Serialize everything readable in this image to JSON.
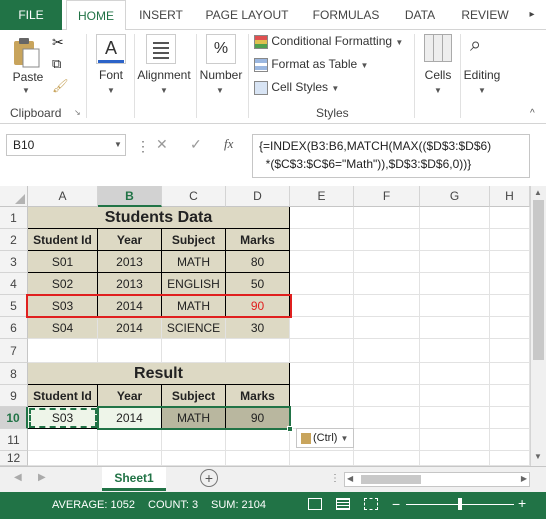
{
  "ribbon_tabs": [
    "FILE",
    "HOME",
    "INSERT",
    "PAGE LAYOUT",
    "FORMULAS",
    "DATA",
    "REVIEW"
  ],
  "clipboard": {
    "paste": "Paste",
    "label": "Clipboard"
  },
  "font_label": "Font",
  "alignment_label": "Alignment",
  "number": {
    "label": "Number",
    "symbol": "%"
  },
  "styles": {
    "conditional": "Conditional Formatting",
    "format_table": "Format as Table",
    "cell_styles": "Cell Styles",
    "label": "Styles"
  },
  "cells_label": "Cells",
  "editing_label": "Editing",
  "name_box": "B10",
  "fx": "fx",
  "formula": "{=INDEX(B3:B6,MATCH(MAX(($D$3:$D$6)\n  *($C$3:$C$6=\"Math\")),$D$3:$D$6,0))}",
  "columns": [
    "A",
    "B",
    "C",
    "D",
    "E",
    "F",
    "G",
    "H"
  ],
  "rows": [
    "1",
    "2",
    "3",
    "4",
    "5",
    "6",
    "7",
    "8",
    "9",
    "10",
    "11",
    "12"
  ],
  "students_title": "Students Data",
  "headers": [
    "Student Id",
    "Year",
    "Subject",
    "Marks"
  ],
  "students": [
    [
      "S01",
      "2013",
      "MATH",
      "80"
    ],
    [
      "S02",
      "2013",
      "ENGLISH",
      "50"
    ],
    [
      "S03",
      "2014",
      "MATH",
      "90"
    ],
    [
      "S04",
      "2014",
      "SCIENCE",
      "30"
    ]
  ],
  "result_title": "Result",
  "result_row": [
    "S03",
    "2014",
    "MATH",
    "90"
  ],
  "paste_options": "(Ctrl)",
  "sheet_tab": "Sheet1",
  "status": {
    "average": "AVERAGE: 1052",
    "count": "COUNT: 3",
    "sum": "SUM: 2104"
  },
  "colors": {
    "accent": "#217346",
    "table_fill": "#ddd9c4",
    "highlight_border": "#e0201f",
    "highlight_text": "#e0201f"
  }
}
